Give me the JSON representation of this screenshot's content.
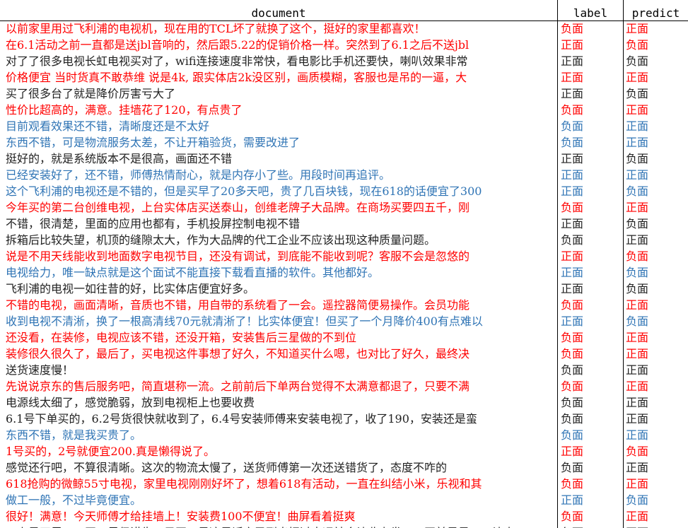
{
  "headers": {
    "document": "document",
    "label": "label",
    "predict": "predict"
  },
  "colors": {
    "red": "#ff0000",
    "blue": "#2f74b5",
    "black": "#222222"
  },
  "rows": [
    {
      "color": "red",
      "document": "以前家里用过飞利浦的电视机，现在用的TCL坏了就换了这个，挺好的家里都喜欢！",
      "label": "负面",
      "predict": "正面"
    },
    {
      "color": "red",
      "document": "在6.1活动之前一直都是送jbl音响的，然后跟5.22的促销价格一样。突然到了6.1之后不送jbl",
      "label": "正面",
      "predict": "负面"
    },
    {
      "color": "black",
      "document": "对了了很多电视长虹电视买对了，wifi连接速度非常快，看电影比手机还要快，喇叭效果非常",
      "label": "正面",
      "predict": "负面"
    },
    {
      "color": "red",
      "document": "价格便宜 当时货真不敢恭维 说是4k, 跟实体店2k没区别，画质模糊，客服也是吊的一逼，大",
      "label": "正面",
      "predict": "正面"
    },
    {
      "color": "black",
      "document": "买了很多台了就是降价厉害亏大了",
      "label": "正面",
      "predict": "负面"
    },
    {
      "color": "red",
      "document": "性价比超高的，满意。挂墙花了120，有点贵了",
      "label": "负面",
      "predict": "正面"
    },
    {
      "color": "blue",
      "document": "目前观看效果还不错，清晰度还是不太好",
      "label": "负面",
      "predict": "正面"
    },
    {
      "color": "blue",
      "document": "东西不错，可是物流服务太差，不让开箱验货，需要改进了",
      "label": "负面",
      "predict": "正面"
    },
    {
      "color": "black",
      "document": "挺好的，就是系统版本不是很高，画面还不错",
      "label": "正面",
      "predict": "负面"
    },
    {
      "color": "blue",
      "document": "已经安装好了，还不错，师傅热情耐心，就是内存小了些。用段时间再追评。",
      "label": "正面",
      "predict": "正面"
    },
    {
      "color": "blue",
      "document": "这个飞利浦的电视还是不错的，但是买早了20多天吧，贵了几百块钱，现在618的话便宜了300",
      "label": "正面",
      "predict": "负面"
    },
    {
      "color": "red",
      "document": "今年买的第二台创维电视，上台实体店买送泰山，创维老牌子大品牌。在商场买要四五千，刚",
      "label": "负面",
      "predict": "正面"
    },
    {
      "color": "black",
      "document": "不错，很清楚，里面的应用也都有，手机投屏控制电视不错",
      "label": "正面",
      "predict": "负面"
    },
    {
      "color": "black",
      "document": "拆箱后比较失望，机顶的缝隙太大，作为大品牌的代工企业不应该出现这种质量问题。",
      "label": "负面",
      "predict": "正面"
    },
    {
      "color": "red",
      "document": "说是不用天线能收到地面数字电视节目，还没有调试，到底能不能收到呢？客服不会是忽悠的",
      "label": "正面",
      "predict": "负面"
    },
    {
      "color": "blue",
      "document": "电视给力，唯一缺点就是这个面试不能直接下载看直播的软件。其他都好。",
      "label": "正面",
      "predict": "负面"
    },
    {
      "color": "black",
      "document": "飞利浦的电视一如往昔的好，比实体店便宜好多。",
      "label": "正面",
      "predict": "负面"
    },
    {
      "color": "red",
      "document": "不错的电视，画面清晰，音质也不错，用自带的系统看了一会。遥控器简便易操作。会员功能",
      "label": "负面",
      "predict": "正面"
    },
    {
      "color": "blue",
      "document": "收到电视不清淅，换了一根高清线70元就清淅了！比实体便宜！但买了一个月降价400有点难以",
      "label": "正面",
      "predict": "负面"
    },
    {
      "color": "red",
      "document": "还没看，在装修，电视应该不错，还没开箱，安装售后三星做的不到位",
      "label": "负面",
      "predict": "正面"
    },
    {
      "color": "red",
      "document": "装修很久很久了，最后了，买电视这件事想了好久，不知道买什么嗯，也对比了好久，最终决",
      "label": "负面",
      "predict": "正面"
    },
    {
      "color": "black",
      "document": "送货速度慢！",
      "label": "负面",
      "predict": "正面"
    },
    {
      "color": "red",
      "document": "先说说京东的售后服务吧，简直堪称一流。之前前后下单两台觉得不太满意都退了，只要不满",
      "label": "负面",
      "predict": "正面"
    },
    {
      "color": "black",
      "document": "电源线太细了，感觉脆弱，放到电视柜上也要收费",
      "label": "负面",
      "predict": "正面"
    },
    {
      "color": "black",
      "document": "6.1号下单买的，6.2号货很快就收到了，6.4号安装师傅来安装电视了，收了190，安装还是蛮",
      "label": "负面",
      "predict": "正面"
    },
    {
      "color": "blue",
      "document": "东西不错，就是我买贵了。",
      "label": "负面",
      "predict": "正面"
    },
    {
      "color": "red",
      "document": "1号买的，2号就便宜200.真是懒得说了。",
      "label": "正面",
      "predict": "负面"
    },
    {
      "color": "black",
      "document": "感觉还行吧，不算很清晰。这次的物流太慢了，送货师傅第一次还送错货了，态度不咋的",
      "label": "负面",
      "predict": "正面"
    },
    {
      "color": "red",
      "document": "618抢购的微鲸55寸电视，家里电视刚刚好坏了，想着618有活动，一直在纠结小米，乐视和其",
      "label": "负面",
      "predict": "正面"
    },
    {
      "color": "blue",
      "document": "做工一般，不过毕竟便宜。",
      "label": "正面",
      "predict": "负面"
    },
    {
      "color": "red",
      "document": "很好！满意！今天师傅才给挂墙上！安装费100不便宜！曲屏看着挺爽",
      "label": "负面",
      "predict": "正面"
    },
    {
      "color": "black",
      "document": "三上是四里，三正三尽但讲生，目正三是这是话之民到出把过中运社会让收力发，三正前是是三三让大",
      "label": "负面",
      "predict": "正面"
    }
  ]
}
